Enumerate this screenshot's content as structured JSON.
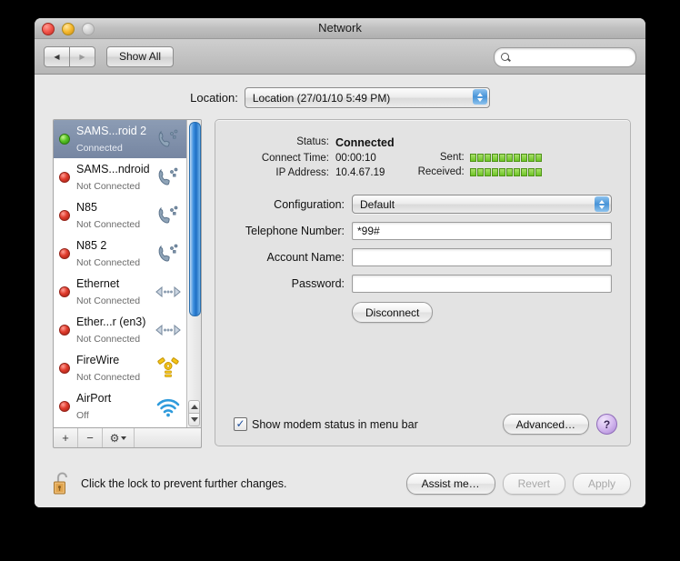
{
  "window": {
    "title": "Network",
    "traffic_lights": [
      "close",
      "minimize",
      "zoom"
    ]
  },
  "toolbar": {
    "back_label": "◀",
    "forward_label": "▶",
    "show_all_label": "Show All",
    "search_placeholder": "",
    "search_value": ""
  },
  "location": {
    "label": "Location:",
    "selected": "Location (27/01/10 5:49 PM)"
  },
  "sidebar": {
    "services": [
      {
        "name": "SAMS...roid 2",
        "status": "Connected",
        "dot": "green",
        "icon": "modem-icon",
        "selected": true
      },
      {
        "name": "SAMS...ndroid",
        "status": "Not Connected",
        "dot": "red",
        "icon": "modem-icon",
        "selected": false
      },
      {
        "name": "N85",
        "status": "Not Connected",
        "dot": "red",
        "icon": "modem-icon",
        "selected": false
      },
      {
        "name": "N85 2",
        "status": "Not Connected",
        "dot": "red",
        "icon": "modem-icon",
        "selected": false
      },
      {
        "name": "Ethernet",
        "status": "Not Connected",
        "dot": "red",
        "icon": "ethernet-icon",
        "selected": false
      },
      {
        "name": "Ether...r (en3)",
        "status": "Not Connected",
        "dot": "red",
        "icon": "ethernet-icon",
        "selected": false
      },
      {
        "name": "FireWire",
        "status": "Not Connected",
        "dot": "red",
        "icon": "firewire-icon",
        "selected": false
      },
      {
        "name": "AirPort",
        "status": "Off",
        "dot": "red",
        "icon": "airport-icon",
        "selected": false
      }
    ],
    "toolbar": {
      "add_label": "+",
      "remove_label": "−",
      "action_label": "⚙"
    }
  },
  "detail": {
    "status_label": "Status:",
    "status_value": "Connected",
    "connect_time_label": "Connect Time:",
    "connect_time_value": "00:00:10",
    "ip_address_label": "IP Address:",
    "ip_address_value": "10.4.67.19",
    "sent_label": "Sent:",
    "received_label": "Received:",
    "sent_segments": 10,
    "received_segments": 10,
    "configuration_label": "Configuration:",
    "configuration_value": "Default",
    "telephone_label": "Telephone Number:",
    "telephone_value": "*99#",
    "account_label": "Account Name:",
    "account_value": "",
    "password_label": "Password:",
    "password_value": "",
    "disconnect_label": "Disconnect",
    "show_status_label": "Show modem status in menu bar",
    "show_status_checked": true,
    "advanced_label": "Advanced…",
    "help_label": "?"
  },
  "footer": {
    "lock_text": "Click the lock to prevent further changes.",
    "assist_label": "Assist me…",
    "revert_label": "Revert",
    "apply_label": "Apply",
    "revert_enabled": false,
    "apply_enabled": false
  },
  "colors": {
    "accent_blue": "#3c8ede",
    "connected_green": "#58c326",
    "disconnected_red": "#e03b2c",
    "help_purple": "#a982d4",
    "traffic_green_segment": "#6ec426"
  }
}
